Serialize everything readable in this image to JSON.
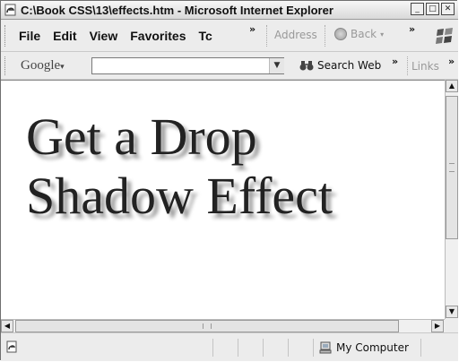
{
  "window": {
    "title": "C:\\Book CSS\\13\\effects.htm - Microsoft Internet Explorer",
    "controls": [
      "minimize-icon",
      "maximize-icon",
      "close-icon"
    ]
  },
  "menu": {
    "items": [
      "File",
      "Edit",
      "View",
      "Favorites",
      "Tc"
    ],
    "overflow_chevron": "»"
  },
  "address_bar": {
    "label": "Address",
    "back_label": "Back",
    "overflow_chevron": "»"
  },
  "google_toolbar": {
    "logo_text": "Google",
    "search_value": "",
    "search_button_label": "Search Web",
    "overflow_chevron": "»",
    "links_label": "Links",
    "links_chevron": "»"
  },
  "page": {
    "headline_line1": "Get a Drop",
    "headline_line2": "Shadow Effect"
  },
  "status_bar": {
    "zone_label": "My Computer"
  }
}
